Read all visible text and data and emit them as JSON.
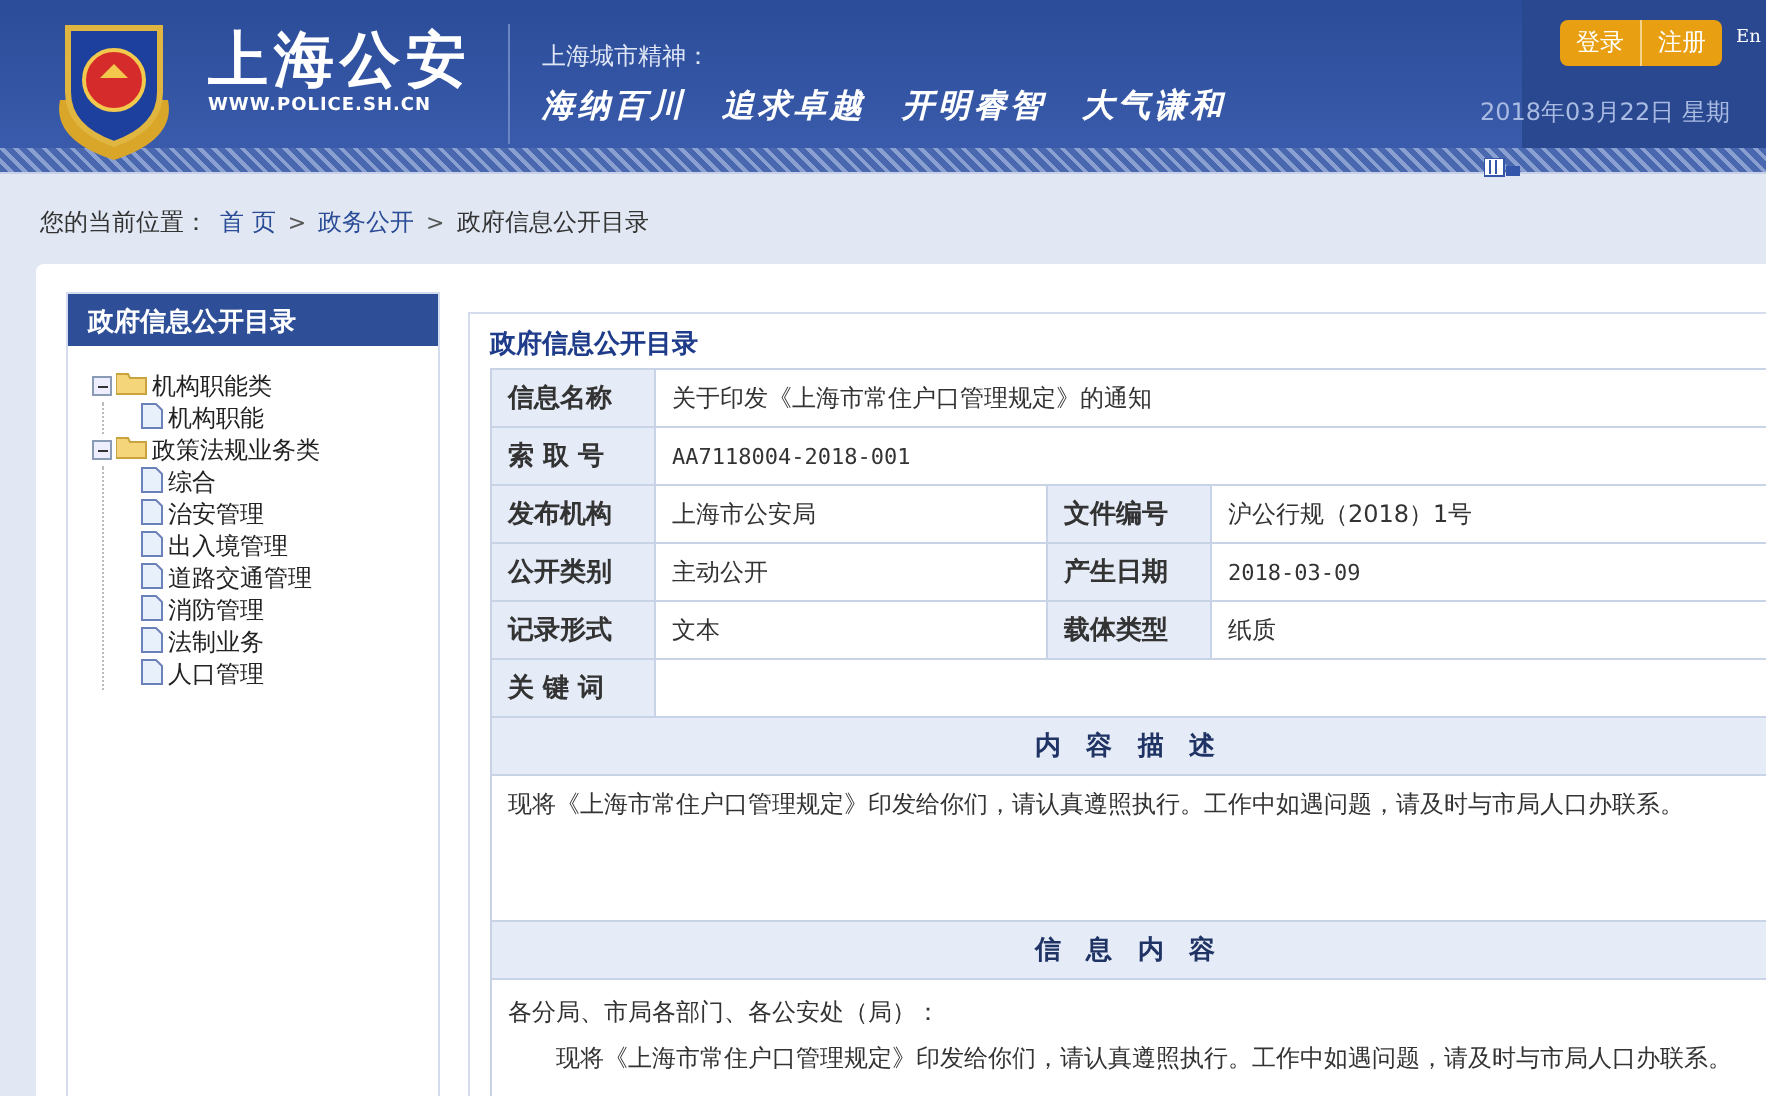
{
  "header": {
    "logo_title": "上海公安",
    "logo_url": "WWW.POLICE.SH.CN",
    "motto_label": "上海城市精神：",
    "mottos": [
      "海纳百川",
      "追求卓越",
      "开明睿智",
      "大气谦和"
    ],
    "buttons": [
      {
        "label": "登录"
      },
      {
        "label": "注册"
      }
    ],
    "language": "En",
    "date": "2018年03月22日 星期"
  },
  "breadcrumb": {
    "prefix": "您的当前位置：",
    "separator": ">",
    "items": [
      "首 页",
      "政务公开",
      "政府信息公开目录"
    ]
  },
  "sidebar": {
    "title": "政府信息公开目录",
    "tree": [
      {
        "label": "机构职能类",
        "expanded": true,
        "children": [
          {
            "label": "机构职能"
          }
        ]
      },
      {
        "label": "政策法规业务类",
        "expanded": true,
        "children": [
          {
            "label": "综合"
          },
          {
            "label": "治安管理"
          },
          {
            "label": "出入境管理"
          },
          {
            "label": "道路交通管理"
          },
          {
            "label": "消防管理"
          },
          {
            "label": "法制业务"
          },
          {
            "label": "人口管理"
          }
        ]
      }
    ]
  },
  "content": {
    "title": "政府信息公开目录",
    "rows": [
      [
        {
          "label": "信息名称",
          "value": "关于印发《上海市常住户口管理规定》的通知"
        }
      ],
      [
        {
          "label": "索 取 号",
          "value": "AA7118004-2018-001"
        }
      ],
      [
        {
          "label": "发布机构",
          "value": "上海市公安局"
        },
        {
          "label": "文件编号",
          "value": "沪公行规（2018）1号"
        }
      ],
      [
        {
          "label": "公开类别",
          "value": "主动公开"
        },
        {
          "label": "产生日期",
          "value": "2018-03-09"
        }
      ],
      [
        {
          "label": "记录形式",
          "value": "文本"
        },
        {
          "label": "载体类型",
          "value": "纸质"
        }
      ],
      [
        {
          "label": "关 键 词"
        }
      ]
    ],
    "description_title": "内 容 描 述",
    "description": "现将《上海市常住户口管理规定》印发给你们，请认真遵照执行。工作中如遇问题，请及时与市局人口办联系。",
    "body_title": "信 息 内 容",
    "body": [
      "各分局、市局各部门、各公安处（局）：",
      "现将《上海市常住户口管理规定》印发给你们，请认真遵照执行。工作中如遇问题，请及时与市局人口办联系。"
    ]
  }
}
